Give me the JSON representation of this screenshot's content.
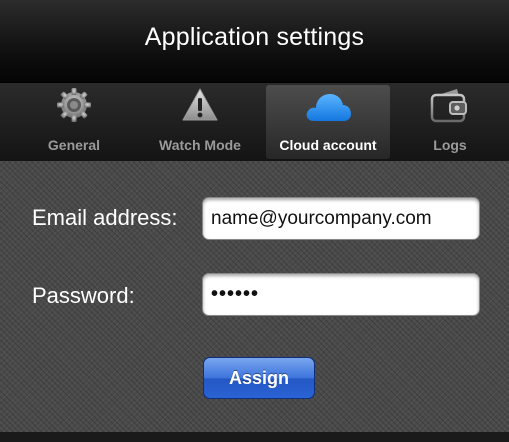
{
  "header": {
    "title": "Application settings"
  },
  "tabs": [
    {
      "label": "General",
      "icon": "gear-icon",
      "active": false
    },
    {
      "label": "Watch Mode",
      "icon": "warning-icon",
      "active": false
    },
    {
      "label": "Cloud account",
      "icon": "cloud-icon",
      "active": true
    },
    {
      "label": "Logs",
      "icon": "wallet-icon",
      "active": false
    }
  ],
  "form": {
    "email_label": "Email address:",
    "email_value": "name@yourcompany.com",
    "password_label": "Password:",
    "password_value": "••••••",
    "assign_label": "Assign"
  },
  "colors": {
    "accent": "#2f6fe0",
    "cloud": "#1e8ff0",
    "tab_text": "#9a9a9a",
    "active_tab_text": "#ffffff"
  }
}
